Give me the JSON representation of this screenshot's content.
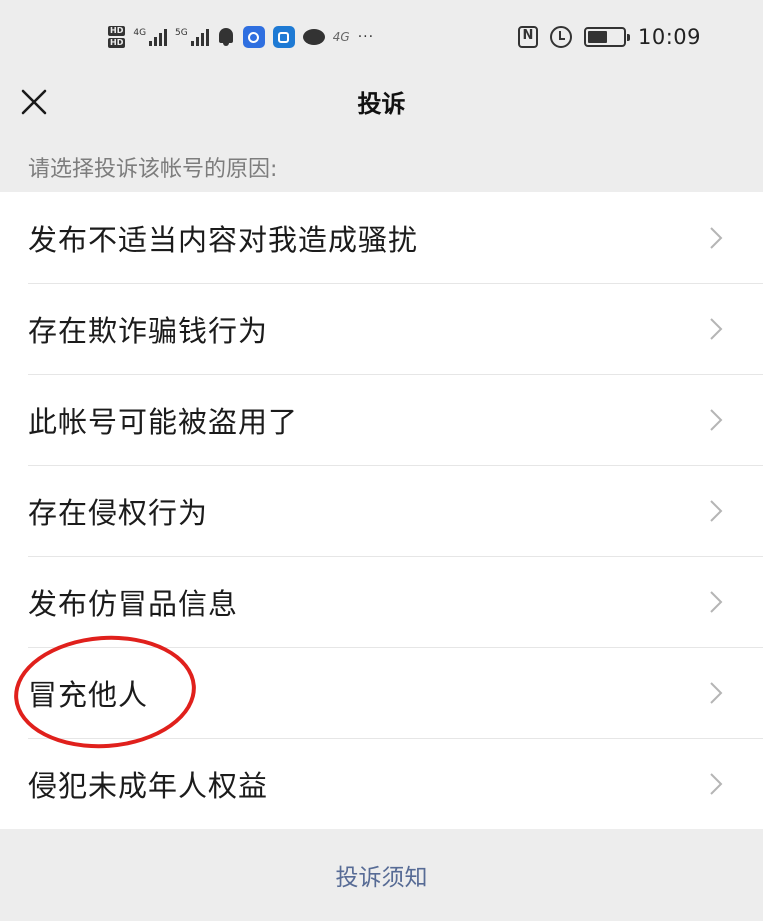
{
  "status_bar": {
    "sim1": "HD",
    "sim2": "HD",
    "net1": "4G",
    "net2": "5G",
    "wifi": "4G",
    "more": "···",
    "nfc": "N",
    "time": "10:09"
  },
  "header": {
    "title": "投诉"
  },
  "prompt": "请选择投诉该帐号的原因:",
  "reasons": [
    {
      "label": "发布不适当内容对我造成骚扰"
    },
    {
      "label": "存在欺诈骗钱行为"
    },
    {
      "label": "此帐号可能被盗用了"
    },
    {
      "label": "存在侵权行为"
    },
    {
      "label": "发布仿冒品信息"
    },
    {
      "label": "冒充他人"
    },
    {
      "label": "侵犯未成年人权益"
    }
  ],
  "footer": {
    "notice_link": "投诉须知"
  },
  "colors": {
    "background": "#ededed",
    "list_background": "#ffffff",
    "link": "#576b95",
    "annotation": "#e0201c"
  },
  "battery_level": 0.55
}
